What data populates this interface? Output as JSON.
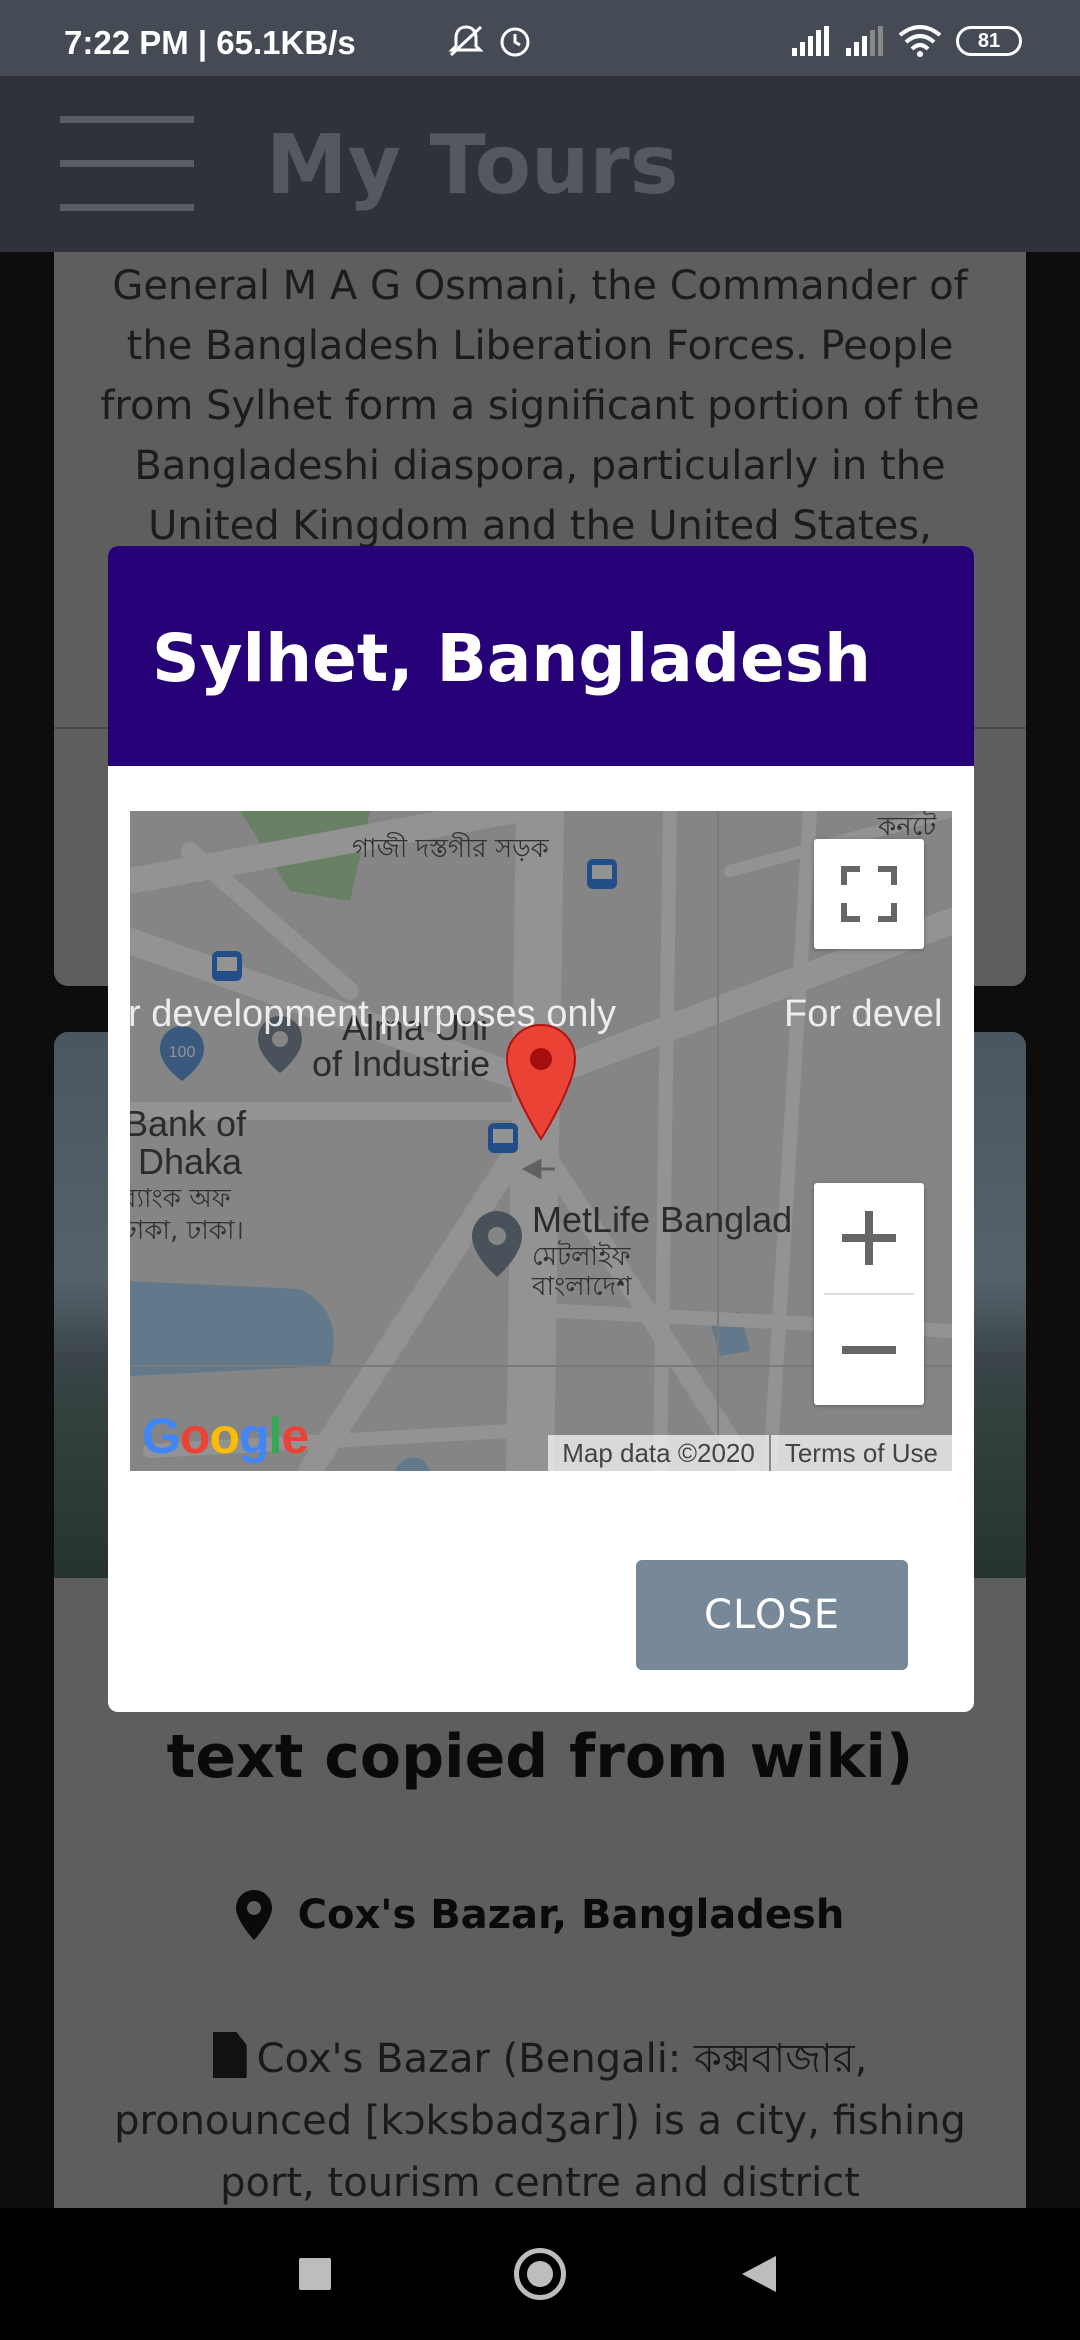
{
  "status_bar": {
    "time": "7:22 PM | 65.1KB/s",
    "battery": "81"
  },
  "app_bar": {
    "title": "My Tours"
  },
  "background_page": {
    "card1_text": "General M A G Osmani, the Commander of the Bangladesh Liberation Forces. People from Sylhet form a significant portion of the Bangladeshi diaspora, particularly in the United Kingdom and the United States,",
    "card2_title": "text copied from wiki)",
    "card2_location": "Cox's Bazar, Bangladesh",
    "card2_description": "Cox's Bazar (Bengali: কক্সবাজার, pronounced [kɔksbadʒar]) is a city, fishing port, tourism centre and district"
  },
  "modal": {
    "title": "Sylhet, Bangladesh",
    "close_label": "CLOSE",
    "map": {
      "dev_watermark_1": "r development purposes only",
      "dev_watermark_2": "For devel",
      "road_label": "গাজী দস্তগীর সড়ক",
      "top_right_label": "কনটে",
      "institute_label_1": "Alma Uni",
      "institute_label_2": "of Industrie",
      "bank_label_1": "Bank of",
      "bank_label_2": "Dhaka",
      "bank_label_bn_1": "ব্যাংক অফ",
      "bank_label_bn_2": "ঢাকা, ঢাকা।",
      "metlife_label": "MetLife Banglad",
      "metlife_label_bn_1": "মেটলাইফ",
      "metlife_label_bn_2": "বাংলাদেশ",
      "bus_route_badge": "100",
      "google_logo": "Google",
      "attribution_data": "Map data ©2020",
      "attribution_terms": "Terms of Use"
    }
  }
}
